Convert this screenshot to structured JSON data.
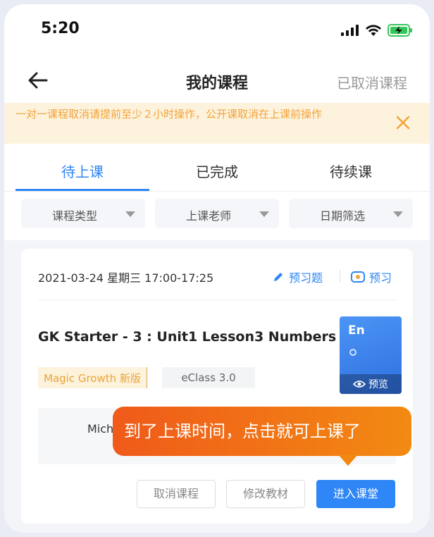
{
  "status": {
    "time": "5:20"
  },
  "nav": {
    "title": "我的课程",
    "right_action": "已取消课程"
  },
  "notice": {
    "text": "一对一课程取消请提前至少２小时操作，公开课取消在上课前操作"
  },
  "tabs": [
    {
      "label": "待上课",
      "active": true
    },
    {
      "label": "已完成",
      "active": false
    },
    {
      "label": "待续课",
      "active": false
    }
  ],
  "filters": [
    {
      "label": "课程类型"
    },
    {
      "label": "上课老师"
    },
    {
      "label": "日期筛选"
    }
  ],
  "lesson": {
    "datetime": "2021-03-24 星期三  17:00-17:25",
    "preview_questions": "预习题",
    "preview": "预习",
    "title": "GK Starter - 3 : Unit1 Lesson3 Numbers",
    "tag_series": "Magic Growth 新版",
    "tag_platform": "eClass 3.0",
    "thumb_label": "En",
    "thumb_preview": "预览",
    "teacher": "Mich",
    "tooltip": "到了上课时间，点击就可上课了",
    "buttons": {
      "cancel": "取消课程",
      "change": "修改教材",
      "enter": "进入课堂"
    }
  },
  "colors": {
    "accent": "#2f86f6",
    "notice_text": "#f2a23a",
    "tooltip": "#f05a1a"
  }
}
